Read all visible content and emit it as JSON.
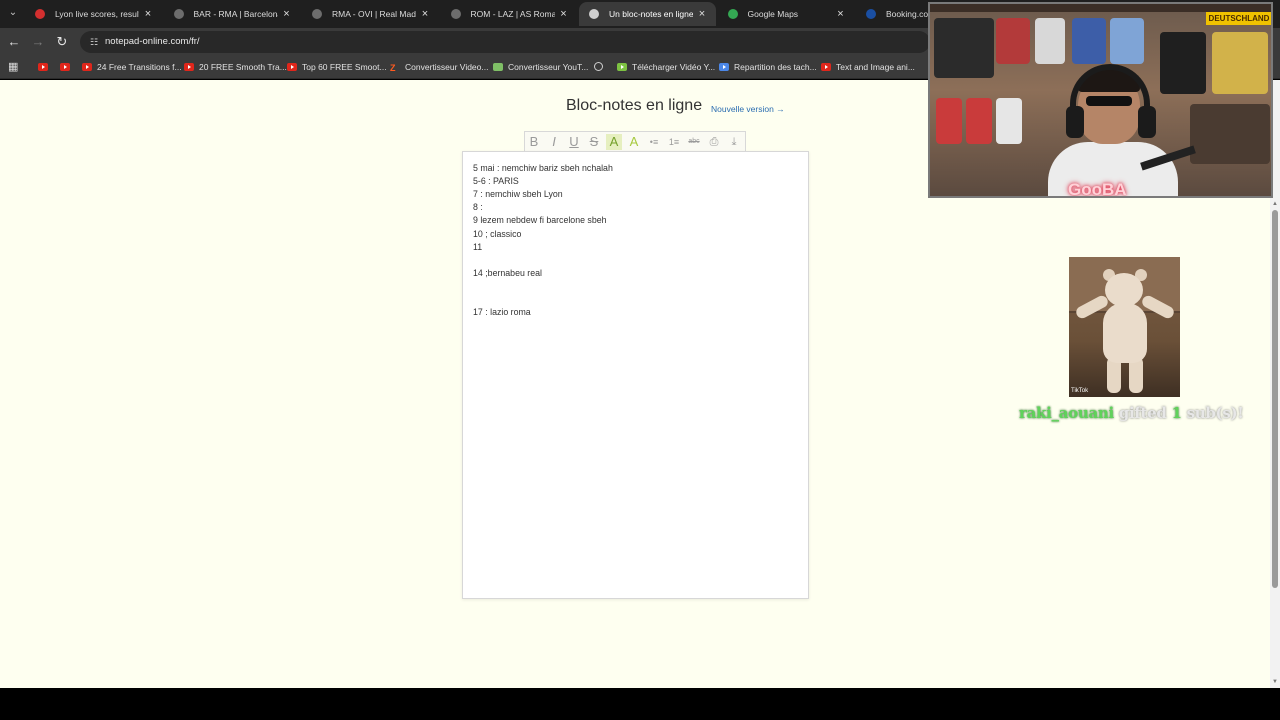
{
  "browser": {
    "tabs": [
      {
        "title": "Lyon live scores, results, fi",
        "favicon_color": "#d32f2f",
        "active": false
      },
      {
        "title": "BAR - RMA | Barcelona v Re",
        "favicon_color": "#6d6d6d",
        "active": false
      },
      {
        "title": "RMA - OVI | Real Madrid - O",
        "favicon_color": "#6d6d6d",
        "active": false
      },
      {
        "title": "ROM - LAZ | AS Roma v La",
        "favicon_color": "#6d6d6d",
        "active": false
      },
      {
        "title": "Un bloc-notes en ligne gra",
        "favicon_color": "#cfcfcf",
        "active": true
      },
      {
        "title": "Google Maps",
        "favicon_color": "#34a853",
        "active": false
      },
      {
        "title": "Booking.com:",
        "favicon_color": "#1a4fa3",
        "active": false
      }
    ],
    "url": "notepad-online.com/fr/",
    "bookmarks": [
      {
        "label": "",
        "icon": "youtube"
      },
      {
        "label": "",
        "icon": "youtube"
      },
      {
        "label": "24 Free Transitions f...",
        "icon": "youtube"
      },
      {
        "label": "20 FREE Smooth Tra...",
        "icon": "youtube"
      },
      {
        "label": "Top 60 FREE Smoot...",
        "icon": "youtube"
      },
      {
        "label": "Convertisseur Video...",
        "icon": "z"
      },
      {
        "label": "Convertisseur YouT...",
        "icon": "plain"
      },
      {
        "label": "",
        "icon": "globe"
      },
      {
        "label": "Télécharger Vidéo Y...",
        "icon": "dl"
      },
      {
        "label": "Repartition des tach...",
        "icon": "doc"
      },
      {
        "label": "Text and Image ani...",
        "icon": "youtube"
      }
    ]
  },
  "page": {
    "title": "Bloc-notes en ligne",
    "new_version_link": "Nouvelle version →",
    "toolbar": [
      "B",
      "I",
      "U",
      "S",
      "A",
      "A",
      "•≡",
      "1≡",
      "abc",
      "⎙",
      "⤓"
    ],
    "notes": [
      "5 mai : nemchiw bariz sbeh nchalah",
      "5-6 : PARIS",
      "7 : nemchiw sbeh Lyon",
      "8 :",
      "9 lezem nebdew fi barcelone sbeh",
      "10 ; classico",
      "11",
      "",
      "14 ;bernabeu real",
      "",
      "",
      "17 : lazio roma"
    ]
  },
  "overlay": {
    "streamer_name": "GooBA",
    "webcam_sign": "DEUTSCHLAND",
    "gif_watermark": "TikTok",
    "gift": {
      "user": "raki_aouani",
      "text": " gifted ",
      "count": "1",
      "unit": " sub(s)!"
    }
  }
}
